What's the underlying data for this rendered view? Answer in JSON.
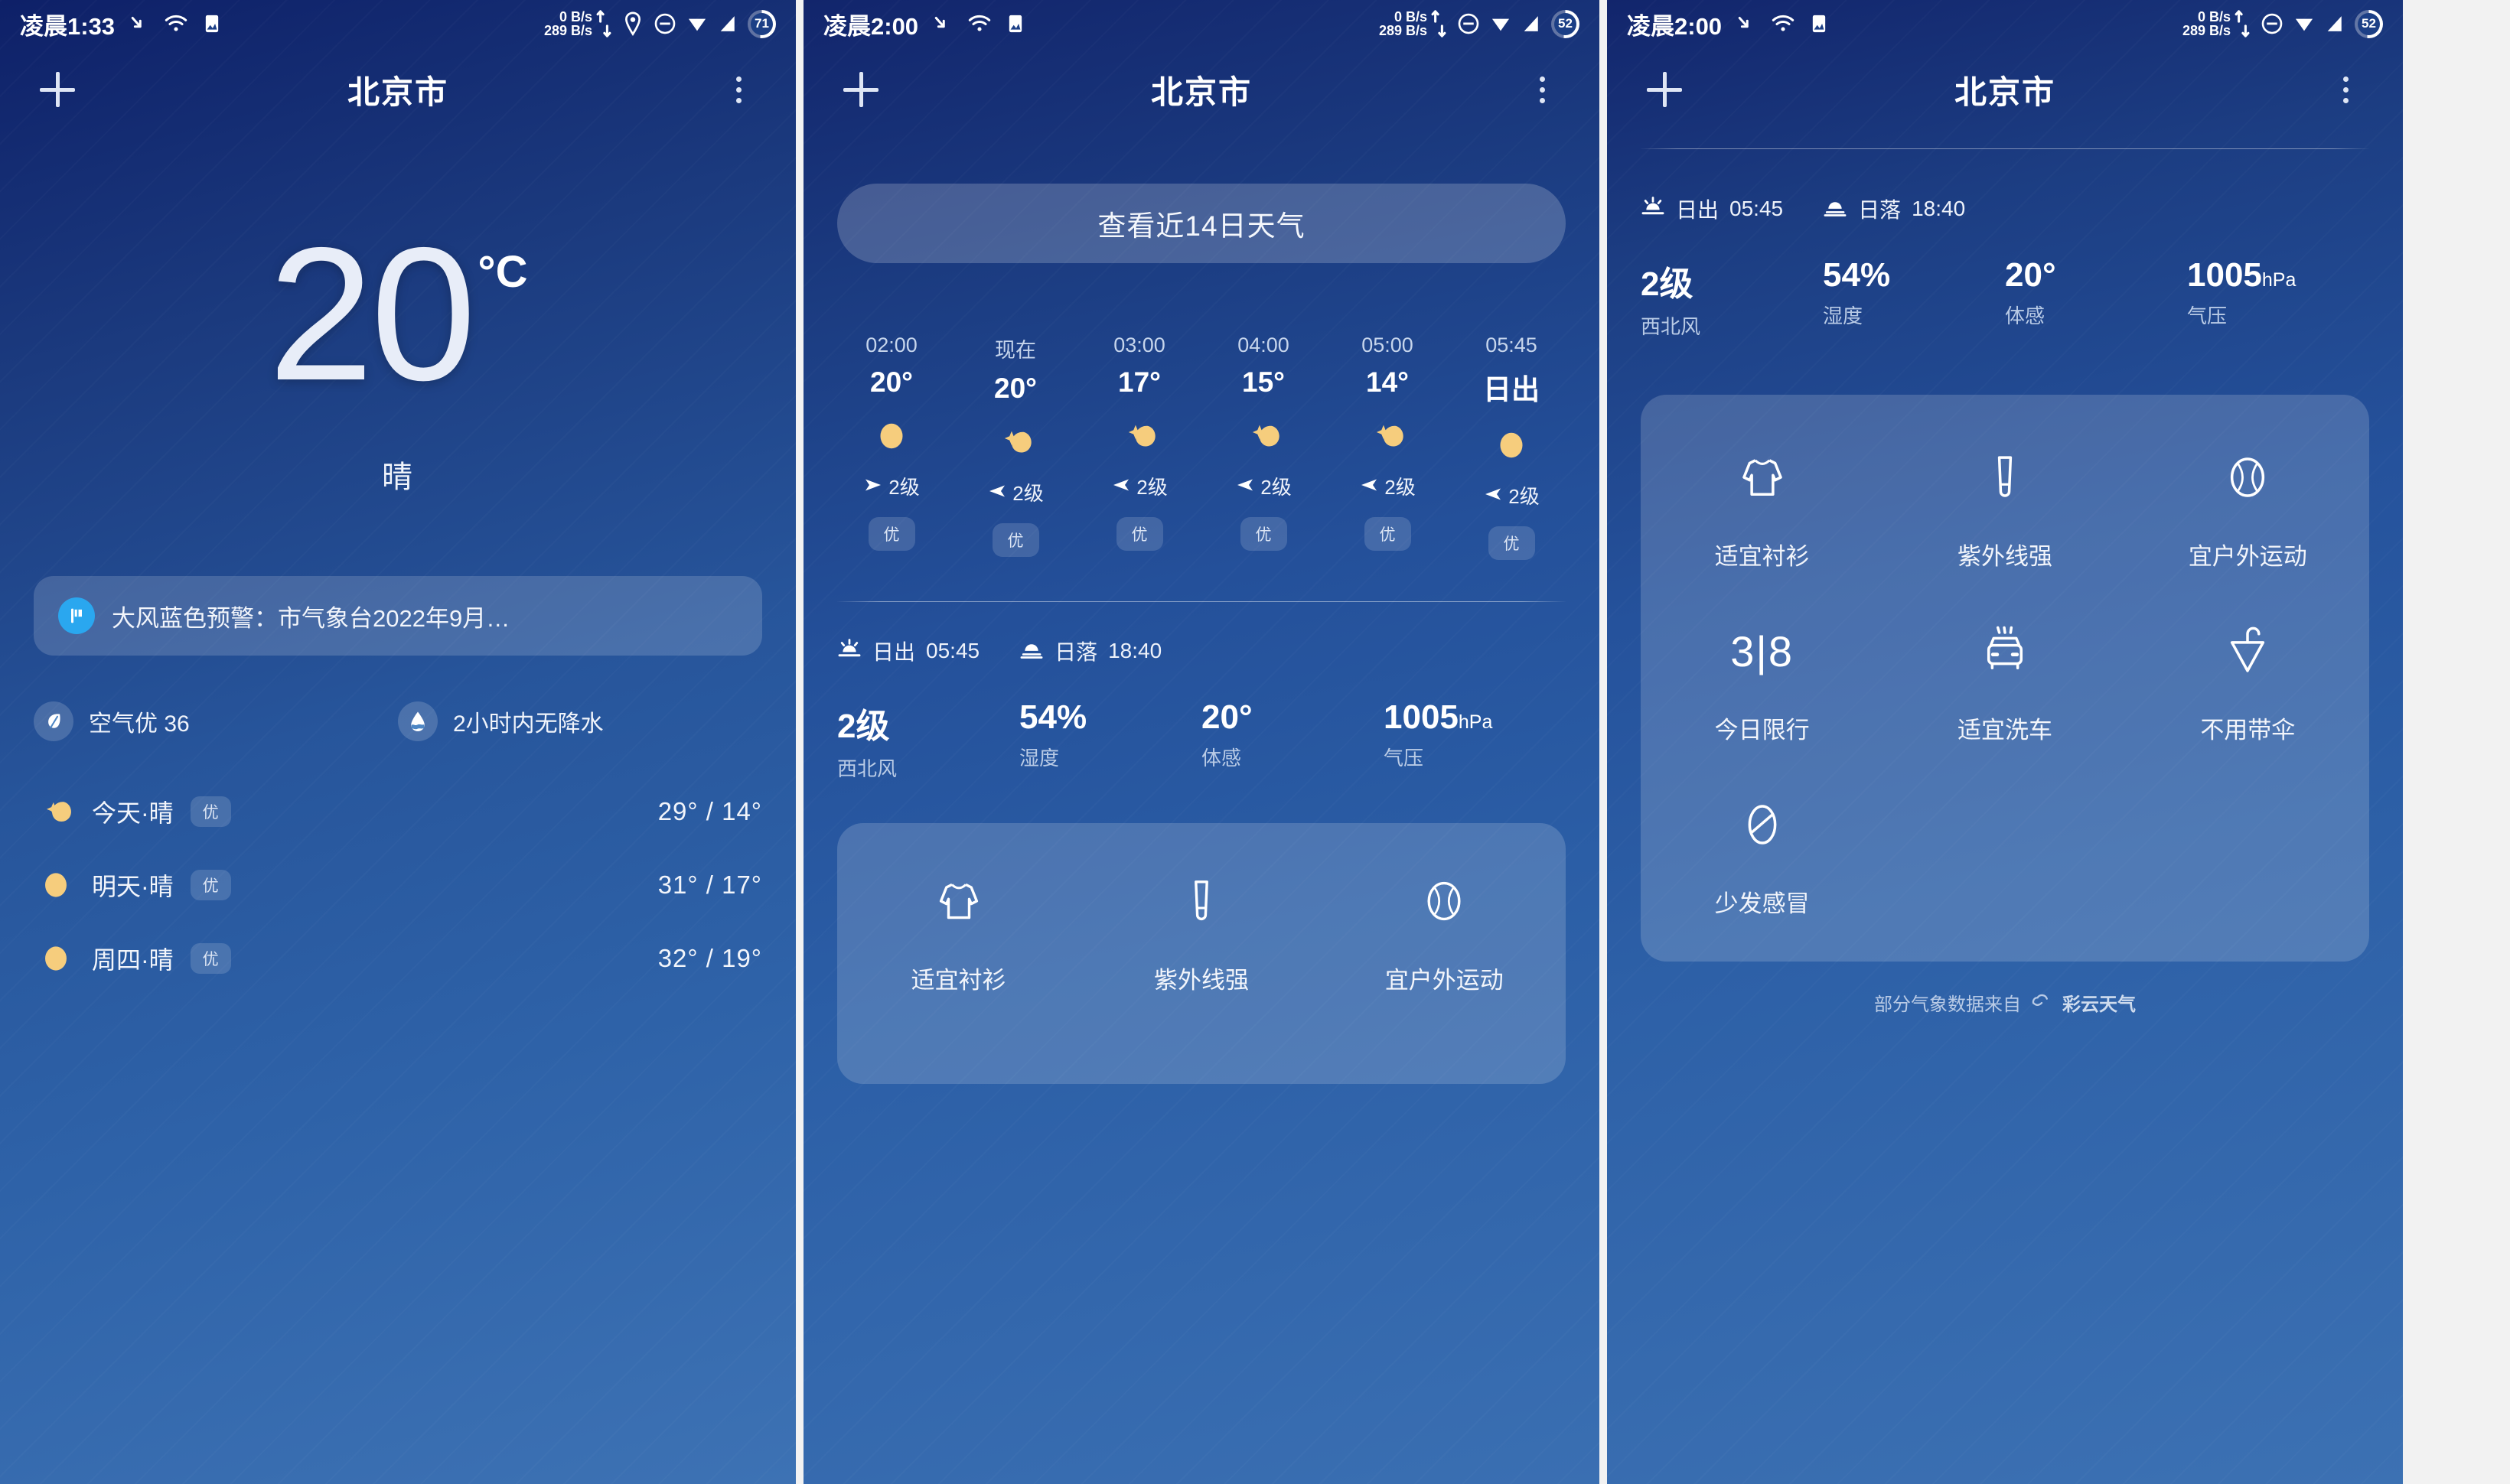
{
  "panels": [
    {
      "status": {
        "time": "凌晨1:33",
        "net_up": "0 B/s",
        "net_down": "289 B/s",
        "battery": "71"
      },
      "appbar": {
        "city": "北京市",
        "add_label": "+",
        "menu_label": "⋮"
      },
      "current": {
        "temp": "20",
        "unit": "°C",
        "condition": "晴"
      },
      "alert": {
        "text": "大风蓝色预警：市气象台2022年9月…"
      },
      "quick": [
        {
          "label": "空气优 36",
          "icon": "leaf-icon"
        },
        {
          "label": "2小时内无降水",
          "icon": "water-drop-icon"
        }
      ],
      "days": [
        {
          "name": "今天·晴",
          "aqi": "优",
          "temp": "29° / 14°",
          "icon": "moon"
        },
        {
          "name": "明天·晴",
          "aqi": "优",
          "temp": "31° / 17°",
          "icon": "sun"
        },
        {
          "name": "周四·晴",
          "aqi": "优",
          "temp": "32° / 19°",
          "icon": "sun"
        }
      ]
    },
    {
      "status": {
        "time": "凌晨2:00",
        "net_up": "0 B/s",
        "net_down": "289 B/s",
        "battery": "52"
      },
      "appbar": {
        "city": "北京市",
        "add_label": "+",
        "menu_label": "⋮"
      },
      "button14": "查看近14日天气",
      "hourly": [
        {
          "time": "02:00",
          "temp": "20°",
          "icon": "sun",
          "wind": "2级",
          "dir": "e",
          "aqi": "优"
        },
        {
          "time": "现在",
          "temp": "20°",
          "icon": "moon",
          "wind": "2级",
          "dir": "nw",
          "aqi": "优"
        },
        {
          "time": "03:00",
          "temp": "17°",
          "icon": "moon",
          "wind": "2级",
          "dir": "nw",
          "aqi": "优"
        },
        {
          "time": "04:00",
          "temp": "15°",
          "icon": "moon",
          "wind": "2级",
          "dir": "nw",
          "aqi": "优"
        },
        {
          "time": "05:00",
          "temp": "14°",
          "icon": "moon",
          "wind": "2级",
          "dir": "nw",
          "aqi": "优"
        },
        {
          "time": "05:45",
          "temp": "日出",
          "icon": "sun",
          "wind": "2级",
          "dir": "nw",
          "aqi": "优"
        }
      ],
      "sun": {
        "sunrise_label": "日出",
        "sunrise": "05:45",
        "sunset_label": "日落",
        "sunset": "18:40"
      },
      "metrics": [
        {
          "value": "2级",
          "unit": "",
          "label": "西北风"
        },
        {
          "value": "54%",
          "unit": "",
          "label": "湿度"
        },
        {
          "value": "20°",
          "unit": "",
          "label": "体感"
        },
        {
          "value": "1005",
          "unit": "hPa",
          "label": "气压"
        }
      ],
      "life": [
        {
          "label": "适宜衬衫",
          "icon": "shirt-icon"
        },
        {
          "label": "紫外线强",
          "icon": "sunscreen-icon"
        },
        {
          "label": "宜户外运动",
          "icon": "tennis-ball-icon"
        }
      ]
    },
    {
      "status": {
        "time": "凌晨2:00",
        "net_up": "0 B/s",
        "net_down": "289 B/s",
        "battery": "52"
      },
      "appbar": {
        "city": "北京市",
        "add_label": "+",
        "menu_label": "⋮"
      },
      "sun": {
        "sunrise_label": "日出",
        "sunrise": "05:45",
        "sunset_label": "日落",
        "sunset": "18:40"
      },
      "metrics": [
        {
          "value": "2级",
          "unit": "",
          "label": "西北风"
        },
        {
          "value": "54%",
          "unit": "",
          "label": "湿度"
        },
        {
          "value": "20°",
          "unit": "",
          "label": "体感"
        },
        {
          "value": "1005",
          "unit": "hPa",
          "label": "气压"
        }
      ],
      "life": [
        {
          "label": "适宜衬衫",
          "icon": "shirt-icon"
        },
        {
          "label": "紫外线强",
          "icon": "sunscreen-icon"
        },
        {
          "label": "宜户外运动",
          "icon": "tennis-ball-icon"
        },
        {
          "label": "今日限行",
          "icon": "car-plate-318-icon",
          "text": "3|8"
        },
        {
          "label": "适宜洗车",
          "icon": "car-wash-icon"
        },
        {
          "label": "不用带伞",
          "icon": "umbrella-icon"
        },
        {
          "label": "少发感冒",
          "icon": "cold-virus-icon"
        }
      ],
      "footer": {
        "text": "部分气象数据来自",
        "brand": "彩云天气"
      }
    }
  ],
  "colors": {
    "accent_alert": "#2aa7ef",
    "sun_yellow": "#f6cd7d",
    "bg_top": "#12256c",
    "bg_bottom": "#3c71b3",
    "text_primary": "#ffffff",
    "text_secondary": "#b9cbe6"
  }
}
